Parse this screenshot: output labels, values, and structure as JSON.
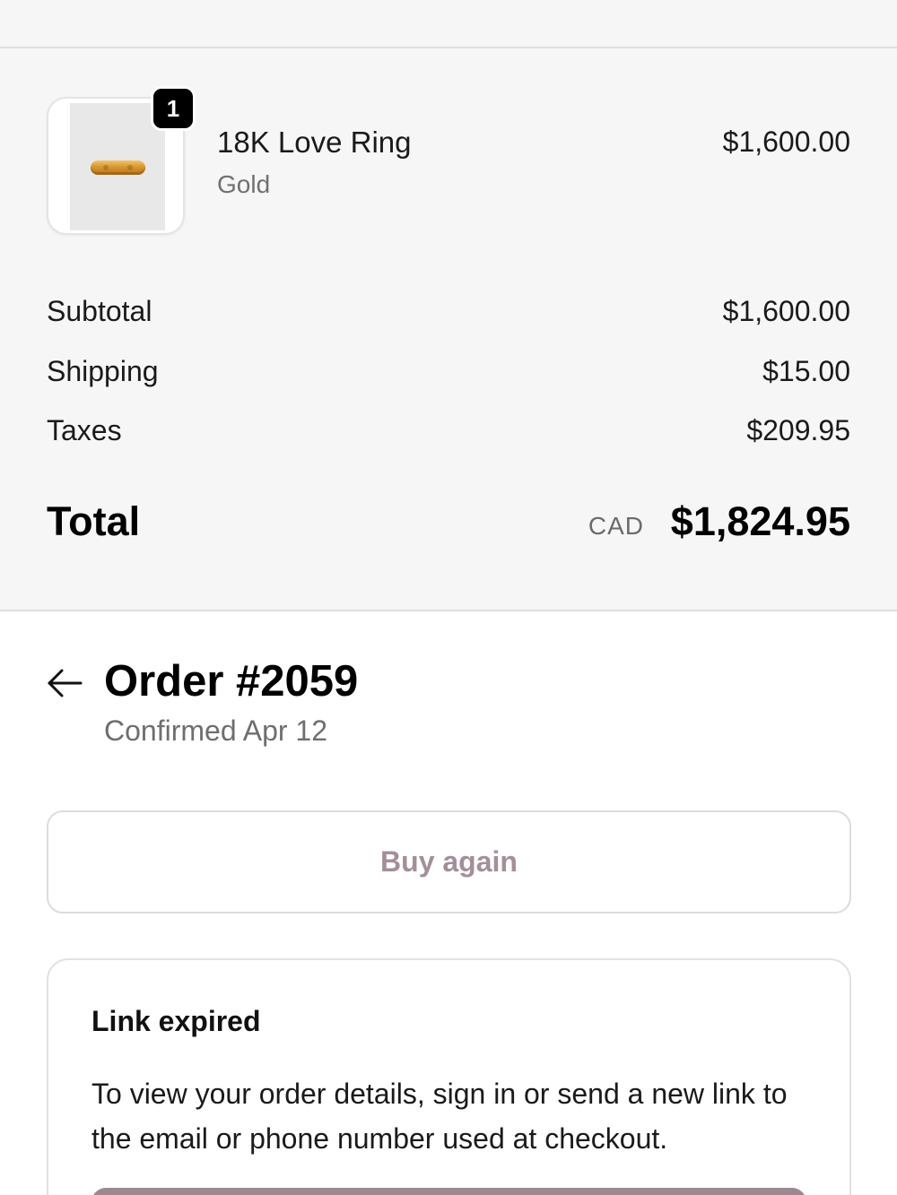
{
  "product": {
    "quantity": "1",
    "name": "18K Love Ring",
    "variant": "Gold",
    "price": "$1,600.00"
  },
  "costs": {
    "subtotal_label": "Subtotal",
    "subtotal_value": "$1,600.00",
    "shipping_label": "Shipping",
    "shipping_value": "$15.00",
    "taxes_label": "Taxes",
    "taxes_value": "$209.95",
    "total_label": "Total",
    "total_currency": "CAD",
    "total_value": "$1,824.95"
  },
  "order": {
    "title": "Order #2059",
    "status": "Confirmed Apr 12"
  },
  "actions": {
    "buy_again_label": "Buy again"
  },
  "notice": {
    "title": "Link expired",
    "body": "To view your order details, sign in or send a new link to the email or phone number used at checkout."
  },
  "colors": {
    "accent": "#9c8891",
    "summary_background": "#f6f6f6"
  },
  "icons": {
    "back": "arrow-left-icon"
  }
}
